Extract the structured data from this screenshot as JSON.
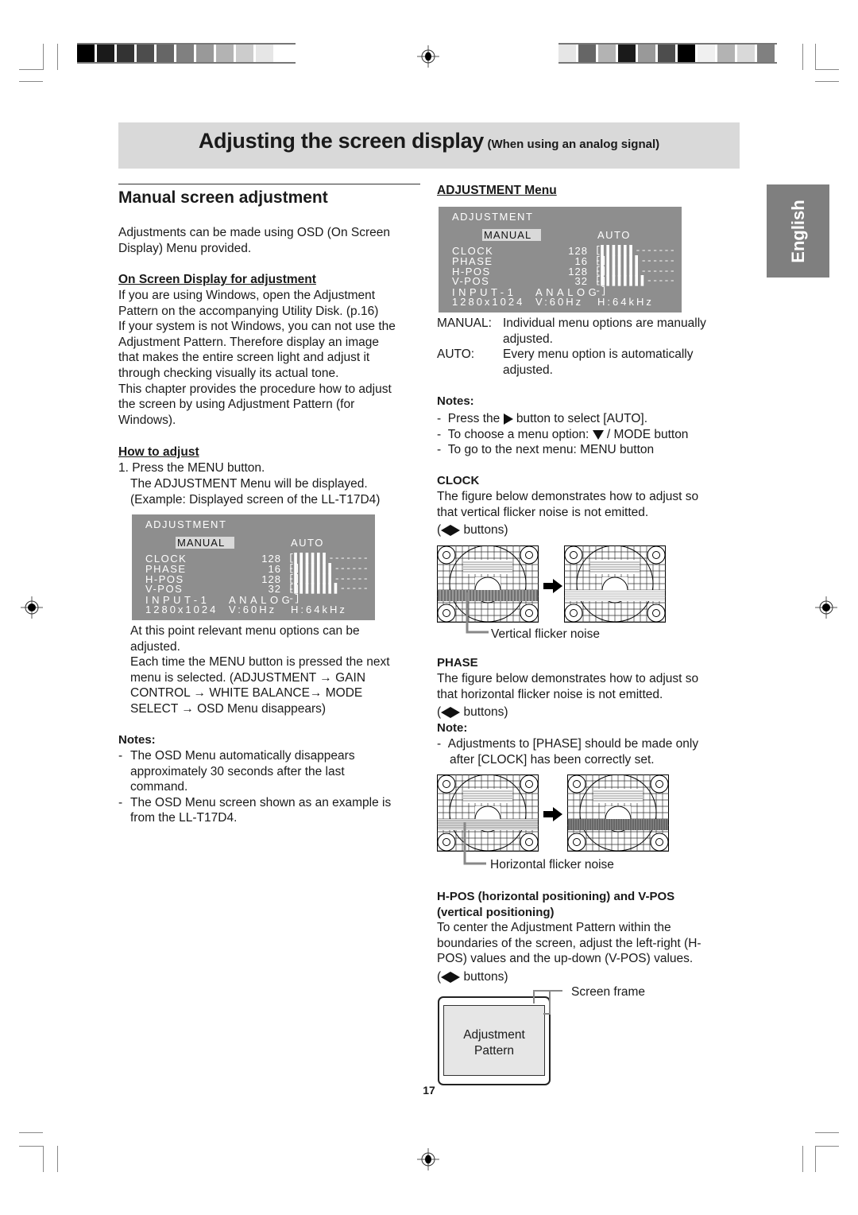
{
  "header": {
    "title": "Adjusting the screen display",
    "subtitle": "(When using an analog signal)",
    "language_tab": "English",
    "left_color_bars": [
      "#000000",
      "#1a1a1a",
      "#333333",
      "#4d4d4d",
      "#666666",
      "#808080",
      "#999999",
      "#b3b3b3",
      "#cccccc",
      "#e6e6e6",
      "#ffffff"
    ],
    "right_color_bars": [
      "#e6e6e6",
      "#666666",
      "#b3b3b3",
      "#1a1a1a",
      "#999999",
      "#4d4d4d",
      "#000000",
      "#f0f0f0",
      "#b3b3b3",
      "#d9d9d9",
      "#808080"
    ]
  },
  "left": {
    "section_title": "Manual screen adjustment",
    "intro": [
      "Adjustments can be made using OSD (On Screen",
      "Display) Menu provided."
    ],
    "osd_heading": "On Screen Display for adjustment",
    "osd_paragraph": [
      "If you are using Windows, open the Adjustment",
      "Pattern on the accompanying Utility Disk. (p.16)",
      "If your system is not Windows, you can not use the",
      "Adjustment Pattern. Therefore display an image",
      "that makes the entire screen light and adjust it",
      "through checking visually its actual tone.",
      "This chapter provides the procedure how to adjust",
      "the screen by using Adjustment Pattern (for",
      "Windows)."
    ],
    "how_heading": "How to adjust",
    "step1": "1. Press the MENU button.",
    "step1_detail": [
      "The ADJUSTMENT Menu will be displayed.",
      "(Example: Displayed screen of the LL-T17D4)"
    ],
    "after_osd": [
      "At this point relevant menu options can be",
      "adjusted.",
      "Each time the MENU button is pressed the next",
      "menu is selected. (ADJUSTMENT → GAIN",
      "CONTROL → WHITE BALANCE→ MODE",
      "SELECT → OSD Menu disappears)"
    ],
    "notes_title": "Notes:",
    "notes": [
      [
        "-",
        "The OSD Menu automatically disappears",
        "approximately 30 seconds after the last",
        "command."
      ],
      [
        "-",
        "The OSD Menu screen shown as an example is",
        "from the LL-T17D4."
      ]
    ]
  },
  "osd": {
    "title": "ADJUSTMENT",
    "manual": "MANUAL",
    "auto": "AUTO",
    "rows": [
      {
        "label": "CLOCK",
        "value": "128",
        "bar": "[▌▌▌▌▌▌--------]"
      },
      {
        "label": "PHASE",
        "value": "16",
        "bar": "[▌▌▌▌▌▌▌-------]"
      },
      {
        "label": "H-POS",
        "value": "128",
        "bar": "[▌▌▌▌▌▌▌-------]"
      },
      {
        "label": "V-POS",
        "value": "32",
        "bar": "[▌▌▌▌▌▌▌▌------]"
      }
    ],
    "input": "INPUT-1",
    "signal": "ANALOG",
    "resolution": "1280x1024",
    "vfreq": "V:60Hz",
    "hfreq": "H:64kHz"
  },
  "right": {
    "menu_heading": "ADJUSTMENT Menu",
    "manual_term": "MANUAL:",
    "manual_desc": [
      "Individual menu options are manually",
      "adjusted."
    ],
    "auto_term": "AUTO:",
    "auto_desc": [
      "Every menu option is automatically",
      "adjusted."
    ],
    "notes_title": "Notes:",
    "notes": [
      {
        "pre": "Press the ",
        "icon": "right",
        "post": " button to select [AUTO]."
      },
      {
        "pre": "To choose a menu option: ",
        "icon": "down",
        "post": " / MODE button"
      },
      {
        "pre": "To go to the next menu: MENU button",
        "icon": "",
        "post": ""
      }
    ],
    "clock_heading": "CLOCK",
    "clock_text": [
      "The figure below demonstrates how to adjust so",
      "that vertical flicker noise is not emitted."
    ],
    "buttons_label": "buttons)",
    "vertical_caption": "Vertical flicker noise",
    "phase_heading": "PHASE",
    "phase_text": [
      "The figure below demonstrates how to adjust so",
      "that horizontal flicker noise is not emitted."
    ],
    "note_title": "Note:",
    "phase_note": [
      "Adjustments to [PHASE] should be made only",
      "after [CLOCK] has been correctly set."
    ],
    "horizontal_caption": "Horizontal flicker noise",
    "hpos_heading": [
      "H-POS (horizontal positioning) and V-POS",
      "(vertical positioning)"
    ],
    "hpos_text": [
      "To center the Adjustment Pattern within the",
      "boundaries of the screen, adjust the left-right (H-",
      "POS) values and the up-down (V-POS) values."
    ],
    "screen_frame": "Screen frame",
    "adjustment_pattern": [
      "Adjustment",
      "Pattern"
    ]
  },
  "footer": {
    "page_number": "17"
  }
}
